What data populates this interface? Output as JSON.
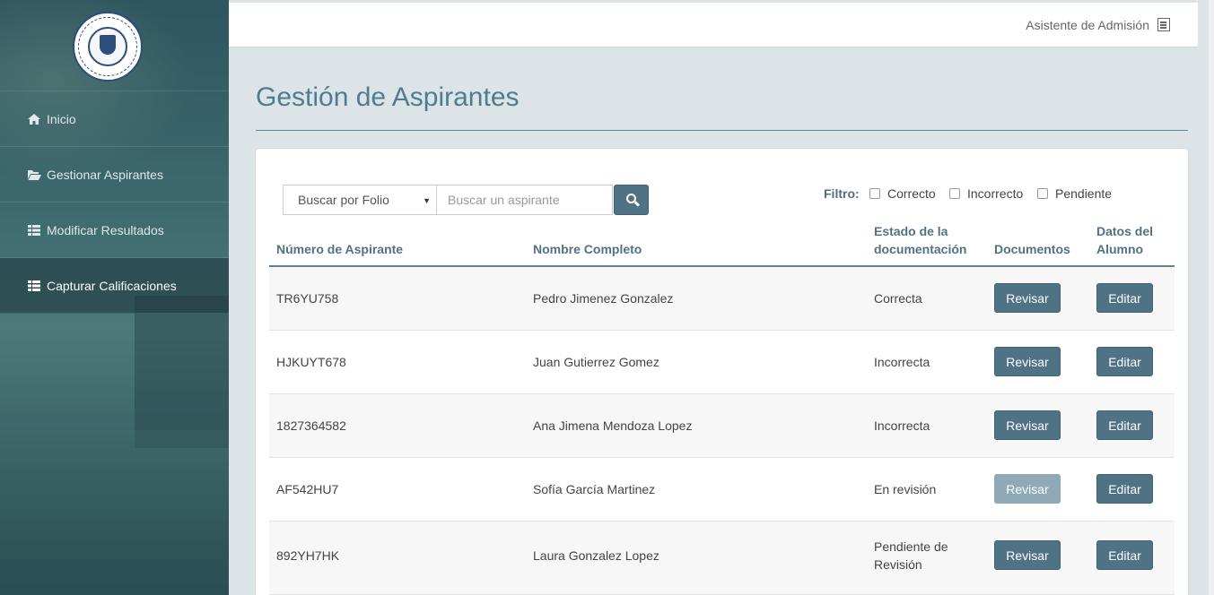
{
  "sidebar": {
    "logo": {
      "text": "STATE UNIVERSITY OF NEW YORK · TO LEARN · TO SEARCH · TO SERVE · 1948"
    },
    "items": [
      {
        "label": "Inicio",
        "icon": "home-icon"
      },
      {
        "label": "Gestionar Aspirantes",
        "icon": "folder-open-icon"
      },
      {
        "label": "Modificar Resultados",
        "icon": "list-icon"
      },
      {
        "label": "Capturar Calificaciones",
        "icon": "list-icon",
        "active": true
      }
    ]
  },
  "topbar": {
    "title": "Asistente de Admisión",
    "icon": "book-icon"
  },
  "page": {
    "title": "Gestión de Aspirantes"
  },
  "search": {
    "mode": "Buscar por Folio",
    "placeholder": "Buscar un aspirante",
    "button_icon": "search-icon"
  },
  "filter": {
    "label": "Filtro:",
    "options": [
      "Correcto",
      "Incorrecto",
      "Pendiente"
    ]
  },
  "table": {
    "headers": {
      "numero": "Número de Aspirante",
      "nombre": "Nombre Completo",
      "estado_l1": "Estado de la",
      "estado_l2": "documentación",
      "documentos": "Documentos",
      "datos_l1": "Datos del",
      "datos_l2": "Alumno"
    },
    "rows": [
      {
        "numero": "TR6YU758",
        "nombre": "Pedro Jimenez Gonzalez",
        "estado_l1": "Correcta",
        "estado_l2": "",
        "revisar": "Revisar",
        "editar": "Editar",
        "revisar_enabled": true
      },
      {
        "numero": "HJKUYT678",
        "nombre": "Juan Gutierrez Gomez",
        "estado_l1": "Incorrecta",
        "estado_l2": "",
        "revisar": "Revisar",
        "editar": "Editar",
        "revisar_enabled": true
      },
      {
        "numero": "1827364582",
        "nombre": "Ana Jimena Mendoza Lopez",
        "estado_l1": "Incorrecta",
        "estado_l2": "",
        "revisar": "Revisar",
        "editar": "Editar",
        "revisar_enabled": true
      },
      {
        "numero": "AF542HU7",
        "nombre": "Sofía García Martinez",
        "estado_l1": "En revisión",
        "estado_l2": "",
        "revisar": "Revisar",
        "editar": "Editar",
        "revisar_enabled": false
      },
      {
        "numero": "892YH7HK",
        "nombre": "Laura Gonzalez Lopez",
        "estado_l1": "Pendiente de",
        "estado_l2": "Revisión",
        "revisar": "Revisar",
        "editar": "Editar",
        "revisar_enabled": true
      }
    ]
  },
  "colors": {
    "accent": "#4f7385",
    "title": "#4f7d8f",
    "button_disabled": "#8faab6"
  }
}
